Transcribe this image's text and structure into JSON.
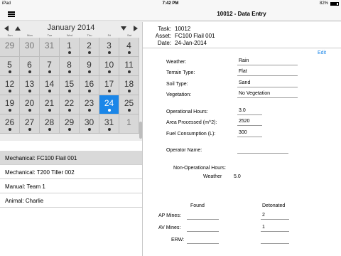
{
  "status_bar": {
    "device": "iPad",
    "time": "7:42 PM",
    "battery": "82%",
    "battery_level": 0.82
  },
  "nav": {
    "title": "10012 - Data Entry"
  },
  "calendar": {
    "month": "January 2014",
    "weekdays": [
      "Sun",
      "Mon",
      "Tue",
      "Wed",
      "Thu",
      "Fri",
      "Sat"
    ],
    "weeks": [
      [
        "29",
        "30",
        "31",
        "1",
        "2",
        "3",
        "4"
      ],
      [
        "5",
        "6",
        "7",
        "8",
        "9",
        "10",
        "11"
      ],
      [
        "12",
        "13",
        "14",
        "15",
        "16",
        "17",
        "18"
      ],
      [
        "19",
        "20",
        "21",
        "22",
        "23",
        "24",
        "25"
      ],
      [
        "26",
        "27",
        "28",
        "29",
        "30",
        "31",
        "1"
      ]
    ],
    "selected": "24"
  },
  "tasks": [
    "Mechanical: FC100 Flail 001",
    "Mechanical: T200 Tiller 002",
    "Manual: Team 1",
    "Animal: Charlie"
  ],
  "header": {
    "task_label": "Task:",
    "task": "10012",
    "asset_label": "Asset:",
    "asset": "FC100 Flail 001",
    "date_label": "Date:",
    "date": "24-Jan-2014"
  },
  "edit_label": "Edit",
  "form": {
    "weather_label": "Weather:",
    "weather": "Rain",
    "terrain_label": "Terrain Type:",
    "terrain": "Flat",
    "soil_label": "Soil Type:",
    "soil": "Sand",
    "vegetation_label": "Vegetation:",
    "vegetation": "No Vegetation",
    "op_hours_label": "Operational Hours:",
    "op_hours": "3.0",
    "area_label": "Area Processed (m^2):",
    "area": "2520",
    "fuel_label": "Fuel Consumption (L):",
    "fuel": "300",
    "operator_label": "Operator Name:",
    "operator": "",
    "nonop_label": "Non-Operational Hours:",
    "nonop_weather_label": "Weather",
    "nonop_weather": "5.0",
    "found_label": "Found",
    "detonated_label": "Detonated",
    "ap_label": "AP Mines:",
    "ap_found": "",
    "ap_detonated": "2",
    "av_label": "AV Mines:",
    "av_found": "",
    "av_detonated": "1",
    "erw_label": "ERW:",
    "erw_found": "",
    "erw_detonated": ""
  }
}
